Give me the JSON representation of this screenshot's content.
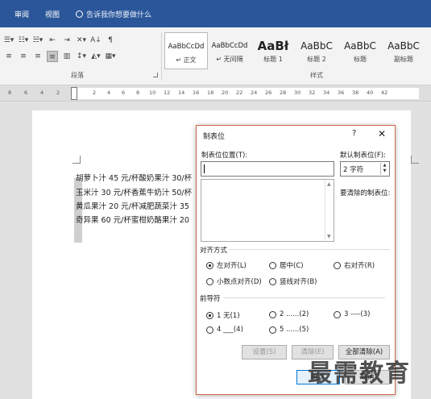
{
  "menubar": {
    "tabs": [
      "审阅",
      "视图"
    ],
    "tell_me": "告诉我你想要做什么"
  },
  "ribbon": {
    "paragraph_group_label": "段落",
    "styles_group_label": "样式",
    "styles": [
      {
        "sample": "AaBbCcDd",
        "name": "↵ 正文"
      },
      {
        "sample": "AaBbCcDd",
        "name": "↵ 无间隔"
      },
      {
        "sample": "AaBł",
        "name": "标题 1"
      },
      {
        "sample": "AaBbC",
        "name": "标题 2"
      },
      {
        "sample": "AaBbC",
        "name": "标题"
      },
      {
        "sample": "AaBbC",
        "name": "副标题"
      }
    ]
  },
  "ruler": {
    "ticks": [
      "8",
      "6",
      "4",
      "2",
      "2",
      "4",
      "6",
      "8",
      "10",
      "12",
      "14",
      "16",
      "18",
      "20",
      "22",
      "24",
      "26",
      "28",
      "30",
      "32",
      "34",
      "36",
      "38",
      "40",
      "42"
    ]
  },
  "document": {
    "lines": [
      "胡萝卜汁 45 元/杯酸奶果汁 30/杯",
      "玉米汁 30 元/杯香蕉牛奶汁 50/杯",
      "黄瓜果汁 20 元/杯减肥蔬菜汁 35",
      "奇异果 60 元/杯蜜柑奶酪果汁 20"
    ]
  },
  "dialog": {
    "title": "制表位",
    "help": "?",
    "close": "✕",
    "tab_position_label": "制表位位置(T):",
    "tab_position_value": "",
    "default_tab_label": "默认制表位(F):",
    "default_tab_value": "2 字符",
    "clear_label": "要清除的制表位:",
    "alignment_label": "对齐方式",
    "alignment_options": [
      {
        "label": "左对齐(L)",
        "checked": true
      },
      {
        "label": "居中(C)",
        "checked": false
      },
      {
        "label": "右对齐(R)",
        "checked": false
      },
      {
        "label": "小数点对齐(D)",
        "checked": false
      },
      {
        "label": "竖线对齐(B)",
        "checked": false
      }
    ],
    "leader_label": "前导符",
    "leader_options": [
      {
        "label": "1 无(1)",
        "checked": true
      },
      {
        "label": "2 ......(2)",
        "checked": false
      },
      {
        "label": "3 ----(3)",
        "checked": false
      },
      {
        "label": "4 ___(4)",
        "checked": false
      },
      {
        "label": "5 ......(5)",
        "checked": false
      }
    ],
    "buttons": {
      "set": "设置(S)",
      "clear": "清除(E)",
      "clear_all": "全部清除(A)",
      "ok": "确定",
      "cancel": "取消"
    }
  },
  "watermark": "最需教育"
}
